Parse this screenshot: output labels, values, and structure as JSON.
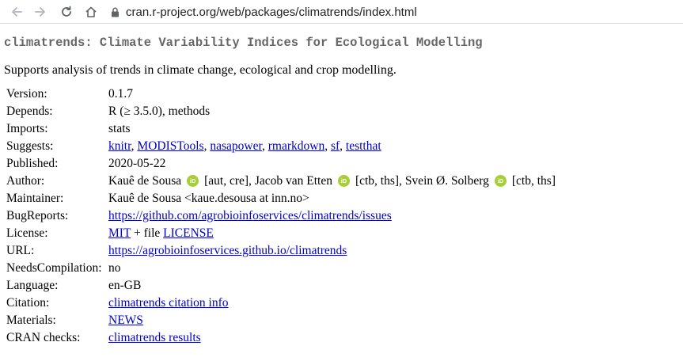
{
  "browser": {
    "url": "cran.r-project.org/web/packages/climatrends/index.html"
  },
  "package": {
    "title": "climatrends: Climate Variability Indices for Ecological Modelling",
    "description": "Supports analysis of trends in climate change, ecological and crop modelling."
  },
  "fields": {
    "version": {
      "label": "Version:",
      "value": "0.1.7"
    },
    "depends": {
      "label": "Depends:",
      "value": "R (≥ 3.5.0), methods"
    },
    "imports": {
      "label": "Imports:",
      "value": "stats"
    },
    "suggests": {
      "label": "Suggests:",
      "links": [
        "knitr",
        "MODISTools",
        "nasapower",
        "rmarkdown",
        "sf",
        "testthat"
      ],
      "sep": ", "
    },
    "published": {
      "label": "Published:",
      "value": "2020-05-22"
    },
    "author": {
      "label": "Author:",
      "people": [
        {
          "name": "Kauê de Sousa",
          "orcid": "iD",
          "roles": "[aut, cre], "
        },
        {
          "name": "Jacob van Etten",
          "orcid": "iD",
          "roles": "[ctb, ths], "
        },
        {
          "name": "Svein Ø. Solberg",
          "orcid": "iD",
          "roles": "[ctb, ths]"
        }
      ]
    },
    "maintainer": {
      "label": "Maintainer:",
      "value": "Kauê de Sousa <kaue.desousa at inn.no>"
    },
    "bugreports": {
      "label": "BugReports:",
      "link": "https://github.com/agrobioinfoservices/climatrends/issues"
    },
    "license": {
      "label": "License:",
      "link1": "MIT",
      "mid": " + file ",
      "link2": "LICENSE"
    },
    "url": {
      "label": "URL:",
      "link": "https://agrobioinfoservices.github.io/climatrends"
    },
    "needscompilation": {
      "label": "NeedsCompilation:",
      "value": "no"
    },
    "language": {
      "label": "Language:",
      "value": "en-GB"
    },
    "citation": {
      "label": "Citation:",
      "link": "climatrends citation info"
    },
    "materials": {
      "label": "Materials:",
      "link": "NEWS"
    },
    "cranchecks": {
      "label": "CRAN checks:",
      "link": "climatrends results"
    }
  },
  "colors": {
    "title_gray": "#666666",
    "link_blue": "#0000cc",
    "orcid_green": "#a6ce39"
  },
  "icons": [
    "back-arrow-icon",
    "forward-arrow-icon",
    "reload-icon",
    "home-icon",
    "lock-icon",
    "orcid-icon"
  ]
}
